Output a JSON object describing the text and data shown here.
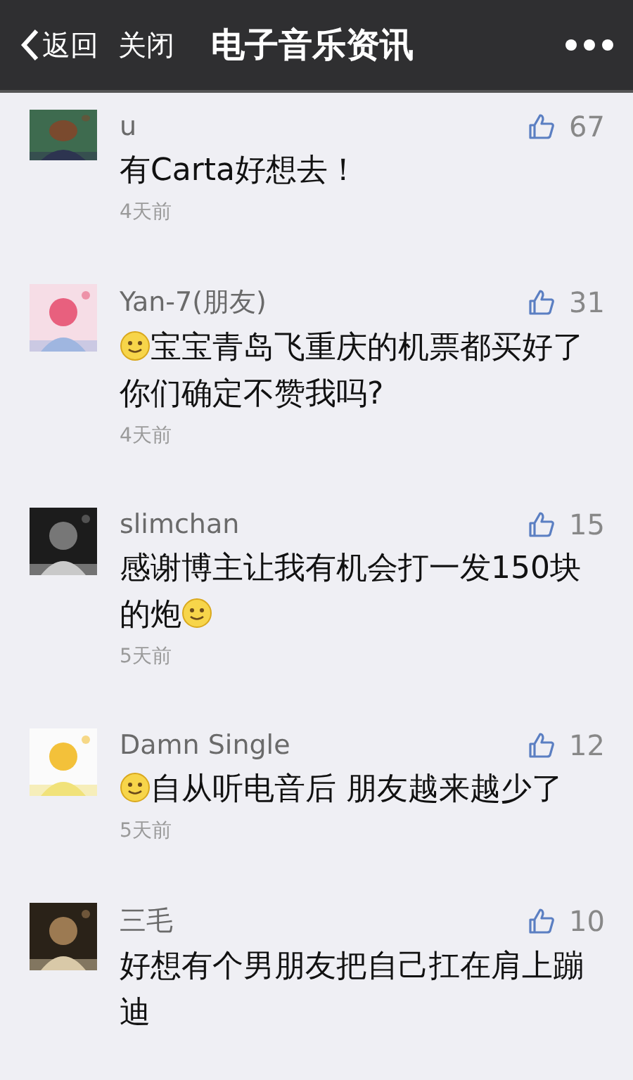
{
  "nav_bar": {
    "back": "返回",
    "close": "关闭",
    "title": "电子音乐资讯"
  },
  "comments": [
    {
      "name": "u",
      "likes": "67",
      "avatar": {
        "kind": "picture"
      },
      "parts": [
        {
          "kind": "text",
          "text": "有Carta好想去！"
        }
      ],
      "time": "4天前"
    },
    {
      "name": "Yan-7(朋友)",
      "likes": "31",
      "avatar": {
        "kind": "picture"
      },
      "parts": [
        {
          "kind": "emoji"
        },
        {
          "kind": "text",
          "text": "宝宝青岛飞重庆的机票都买好了你们确定不赞我吗?"
        }
      ],
      "time": "4天前"
    },
    {
      "name": "slimchan",
      "likes": "15",
      "avatar": {
        "kind": "picture"
      },
      "parts": [
        {
          "kind": "text",
          "text": "感谢博主让我有机会打一发150块的炮"
        },
        {
          "kind": "emoji"
        }
      ],
      "time": "5天前"
    },
    {
      "name": "Damn Single",
      "likes": "12",
      "avatar": {
        "kind": "picture"
      },
      "parts": [
        {
          "kind": "emoji"
        },
        {
          "kind": "text",
          "text": "自从听电音后 朋友越来越少了"
        }
      ],
      "time": "5天前"
    },
    {
      "name": "三毛",
      "likes": "10",
      "avatar": {
        "kind": "picture"
      },
      "parts": [
        {
          "kind": "text",
          "text": "好想有个男朋友把自己扛在肩上蹦迪"
        }
      ]
    }
  ]
}
